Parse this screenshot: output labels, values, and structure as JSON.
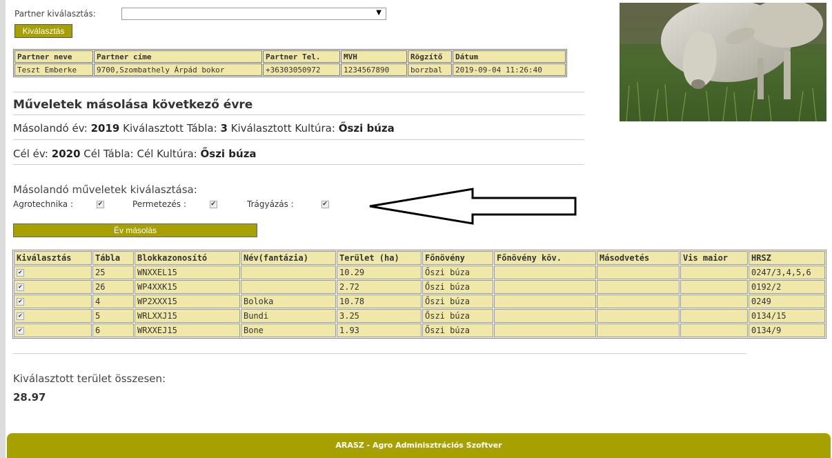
{
  "partner_select": {
    "label": "Partner kiválasztás:",
    "value": "",
    "button": "Kiválasztás"
  },
  "partner_table": {
    "headers": [
      "Partner neve",
      "Partner címe",
      "Partner Tel.",
      "MVH",
      "Rögzítő",
      "Dátum"
    ],
    "row": [
      "Teszt Emberke",
      "9700,Szombathely Árpád bokor",
      "+36303050972",
      "1234567890",
      "borzbal",
      "2019-09-04 11:26:40"
    ]
  },
  "section": {
    "title": "Műveletek másolása következő évre",
    "src_year_label": "Másolandó év:",
    "src_year": "2019",
    "src_table_label": "Kiválasztott Tábla:",
    "src_table": "3",
    "src_culture_label": "Kiválasztott Kultúra:",
    "src_culture": "Őszi búza",
    "dst_year_label": "Cél év:",
    "dst_year": "2020",
    "dst_table_label": "Cél Tábla:",
    "dst_culture_label": "Cél Kultúra:",
    "dst_culture": "Őszi búza"
  },
  "operations": {
    "title": "Másolandó műveletek kiválasztása:",
    "items": [
      {
        "label": "Agrotechnika :",
        "checked": true
      },
      {
        "label": "Permetezés :",
        "checked": true
      },
      {
        "label": "Trágyázás :",
        "checked": true
      }
    ],
    "copy_button": "Év másolás"
  },
  "fields_table": {
    "headers": [
      "Kiválasztás",
      "Tábla",
      "Blokkazonosító",
      "Név(fantázia)",
      "Terület (ha)",
      "Főnövény",
      "Főnövény köv.",
      "Másodvetés",
      "Vis maior",
      "HRSZ"
    ],
    "rows": [
      [
        "✔",
        "25",
        "WNXXEL15",
        "",
        "10.29",
        "Őszi búza",
        "",
        "",
        "",
        "0247/3,4,5,6"
      ],
      [
        "✔",
        "26",
        "WP4XXK15",
        "",
        "2.72",
        "Őszi búza",
        "",
        "",
        "",
        "0192/2"
      ],
      [
        "✔",
        "4",
        "WP2XXX15",
        "Boloka",
        "10.78",
        "Őszi búza",
        "",
        "",
        "",
        "0249"
      ],
      [
        "✔",
        "5",
        "WRLXXJ15",
        "Bundi",
        "3.25",
        "Őszi búza",
        "",
        "",
        "",
        "0134/15"
      ],
      [
        "✔",
        "6",
        "WRXXEJ15",
        "Bone",
        "1.93",
        "Őszi búza",
        "",
        "",
        "",
        "0134/9"
      ]
    ]
  },
  "total": {
    "label": "Kiválasztott terület összesen:",
    "value": "28.97"
  },
  "footer": {
    "text": "ARASZ - Agro Adminisztrációs Szoftver"
  },
  "colors": {
    "accent": "#a6a000",
    "table_bg": "#f0e8a8"
  }
}
